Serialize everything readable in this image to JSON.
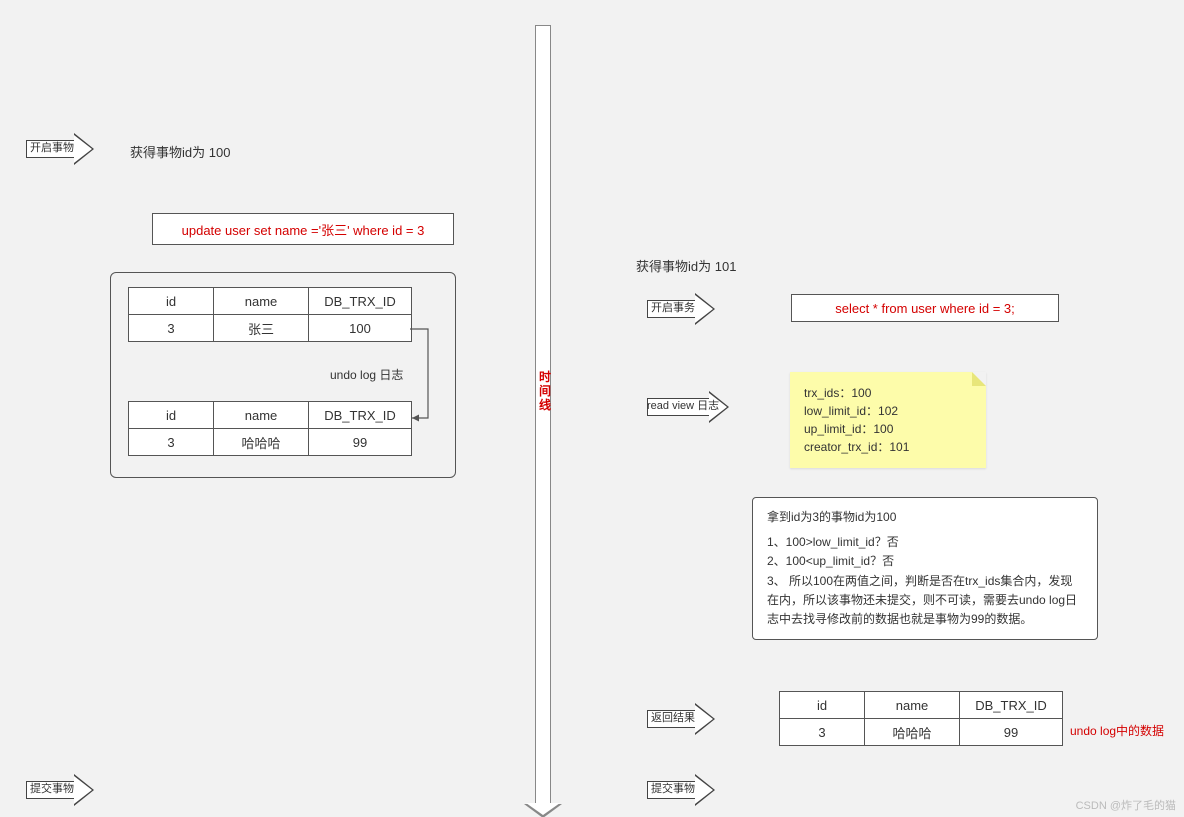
{
  "timeline_label": "时间线",
  "left": {
    "start_arrow": "开启事物",
    "txid_text": "获得事物id为 100",
    "sql": "update user set name ='张三'  where id = 3",
    "undo_label": "undo log 日志",
    "commit_arrow": "提交事物",
    "table1": {
      "headers": [
        "id",
        "name",
        "DB_TRX_ID"
      ],
      "row": [
        "3",
        "张三",
        "100"
      ]
    },
    "table2": {
      "headers": [
        "id",
        "name",
        "DB_TRX_ID"
      ],
      "row": [
        "3",
        "哈哈哈",
        "99"
      ]
    }
  },
  "right": {
    "txid_text": "获得事物id为 101",
    "start_arrow": "开启事务",
    "sql": "select * from user where id = 3;",
    "readview_arrow": "read view 日志",
    "sticky": {
      "l1": "trx_ids：100",
      "l2": "low_limit_id：102",
      "l3": "up_limit_id：100",
      "l4": "creator_trx_id：101"
    },
    "analysis": {
      "title": "拿到id为3的事物id为100",
      "p1": "1、100>low_limit_id？否",
      "p2": "2、100<up_limit_id？否",
      "p3": "3、 所以100在两值之间，判断是否在trx_ids集合内，发现在内，所以该事物还未提交，则不可读，需要去undo log日志中去找寻修改前的数据也就是事物为99的数据。"
    },
    "result_arrow": "返回结果",
    "commit_arrow": "提交事物",
    "result_table": {
      "headers": [
        "id",
        "name",
        "DB_TRX_ID"
      ],
      "row": [
        "3",
        "哈哈哈",
        "99"
      ]
    },
    "result_note": "undo log中的数据"
  },
  "watermark": "CSDN @炸了毛的猫"
}
